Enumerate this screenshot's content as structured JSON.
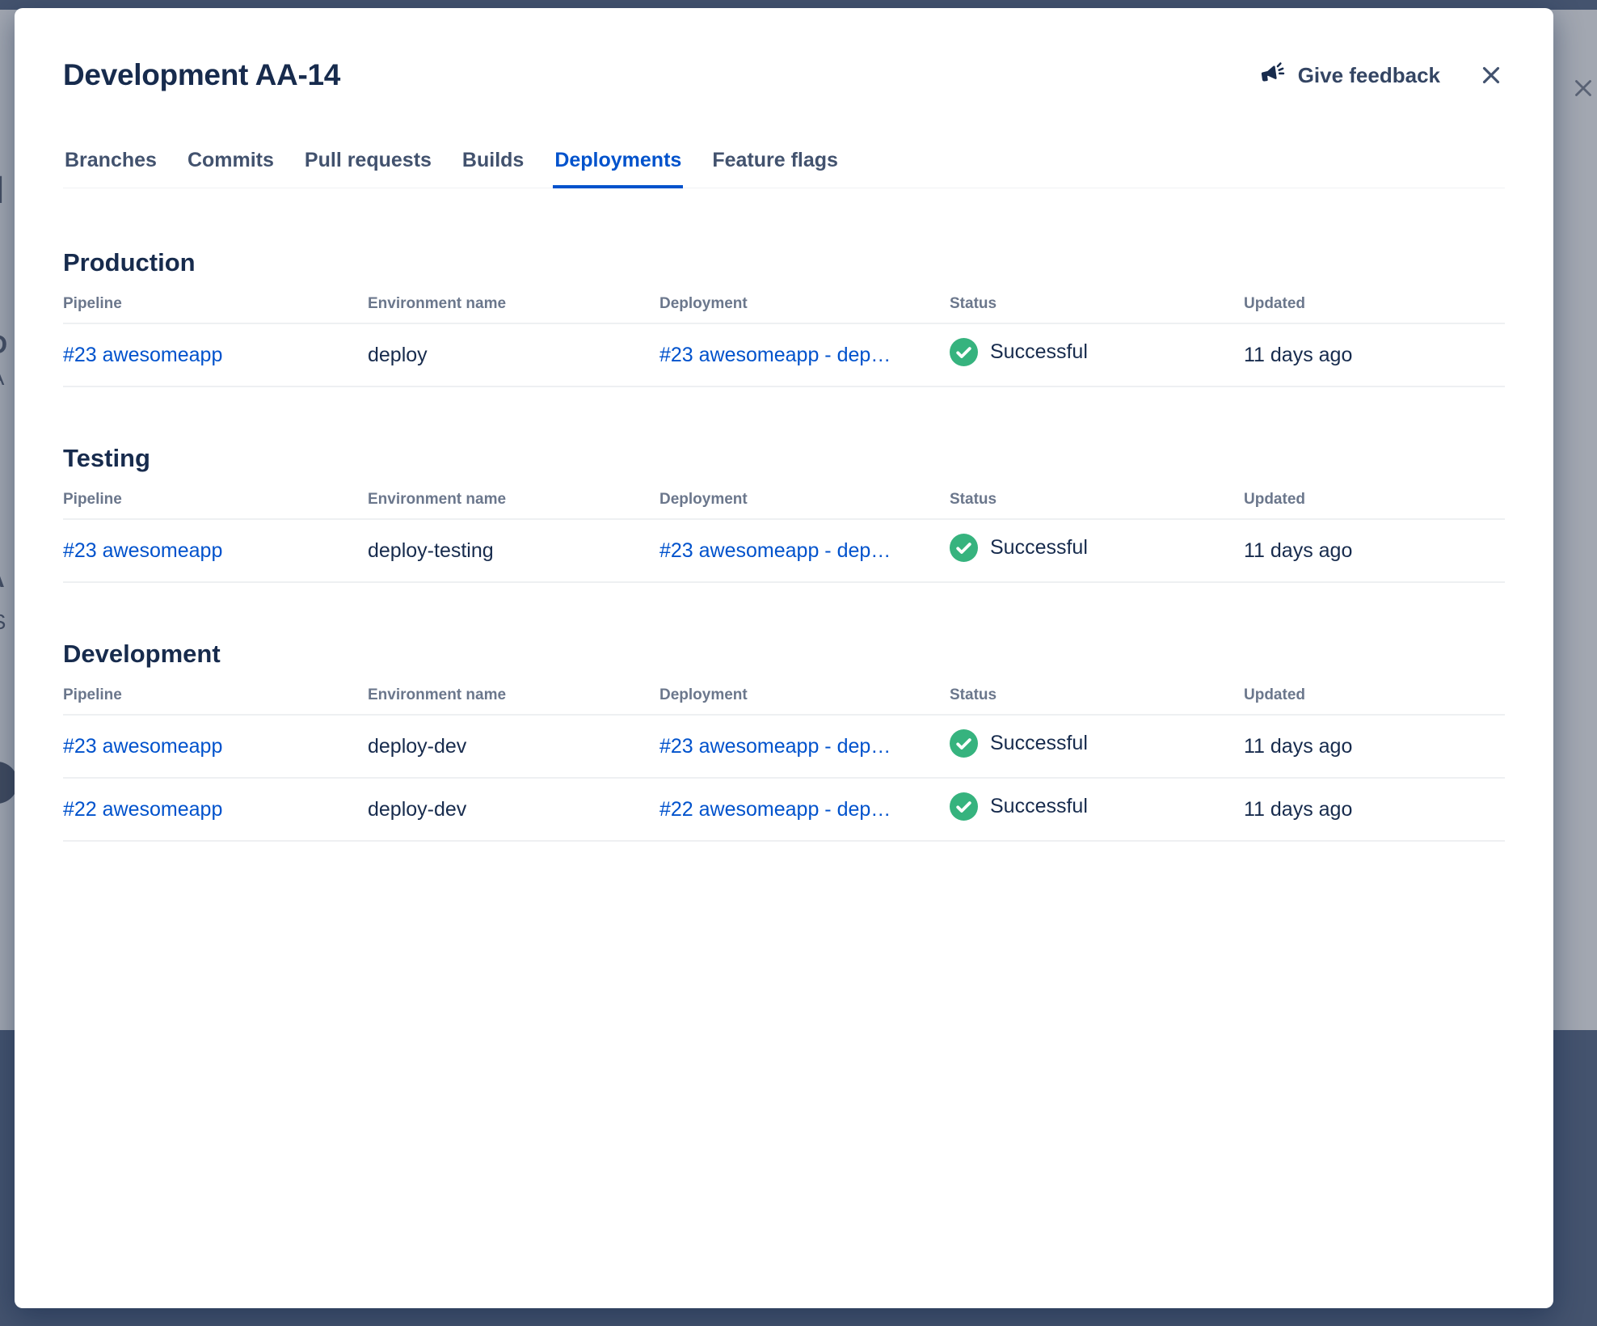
{
  "backdrop": {
    "fragments": [
      "I",
      "D",
      "A",
      "A",
      "S"
    ]
  },
  "modal": {
    "title": "Development AA-14",
    "feedback_label": "Give feedback"
  },
  "tabs": [
    {
      "label": "Branches",
      "active": false
    },
    {
      "label": "Commits",
      "active": false
    },
    {
      "label": "Pull requests",
      "active": false
    },
    {
      "label": "Builds",
      "active": false
    },
    {
      "label": "Deployments",
      "active": true
    },
    {
      "label": "Feature flags",
      "active": false
    }
  ],
  "columns": [
    "Pipeline",
    "Environment name",
    "Deployment",
    "Status",
    "Updated"
  ],
  "sections": [
    {
      "title": "Production",
      "rows": [
        {
          "pipeline": "#23 awesomeapp",
          "environment": "deploy",
          "deployment": "#23 awesomeapp - dep…",
          "status": "Successful",
          "updated": "11 days ago"
        }
      ]
    },
    {
      "title": "Testing",
      "rows": [
        {
          "pipeline": "#23 awesomeapp",
          "environment": "deploy-testing",
          "deployment": "#23 awesomeapp - dep…",
          "status": "Successful",
          "updated": "11 days ago"
        }
      ]
    },
    {
      "title": "Development",
      "rows": [
        {
          "pipeline": "#23 awesomeapp",
          "environment": "deploy-dev",
          "deployment": "#23 awesomeapp - dep…",
          "status": "Successful",
          "updated": "11 days ago"
        },
        {
          "pipeline": "#22 awesomeapp",
          "environment": "deploy-dev",
          "deployment": "#22 awesomeapp - dep…",
          "status": "Successful",
          "updated": "11 days ago"
        }
      ]
    }
  ],
  "colors": {
    "link": "#0052CC",
    "active_tab": "#0052CC",
    "success_green": "#36B37E",
    "title_text": "#172B4D",
    "muted_text": "#6B778C"
  }
}
